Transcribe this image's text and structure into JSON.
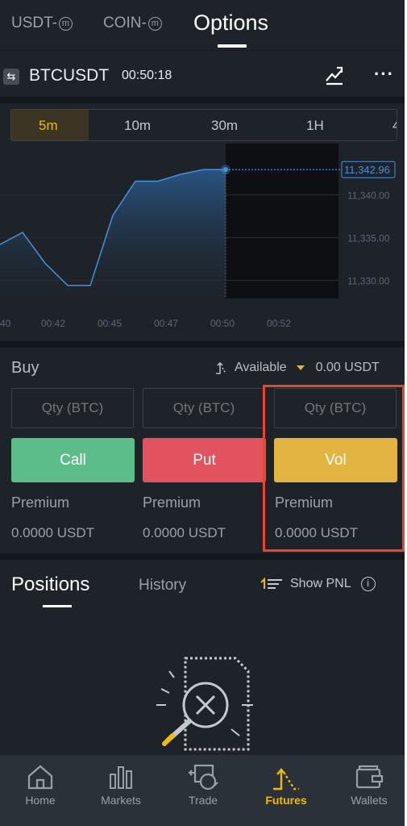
{
  "colors": {
    "background": "#1e2329",
    "accent": "#f0b90b",
    "call": "#5dbd8a",
    "put": "#e2525f",
    "vol": "#e3b442",
    "line": "#4a90d9",
    "highlight": "#e8462a"
  },
  "top_tabs": [
    {
      "label": "USDT-",
      "badge": "m"
    },
    {
      "label": "COIN-",
      "badge": "m"
    },
    {
      "label": "Options",
      "active": true
    }
  ],
  "symbol_bar": {
    "symbol": "BTCUSDT",
    "countdown": "00:50:18",
    "icons": [
      "swap-icon",
      "chart-type-icon",
      "more-icon"
    ]
  },
  "intervals": {
    "items": [
      "5m",
      "10m",
      "30m",
      "1H",
      "4"
    ],
    "selected": "5m"
  },
  "chart_data": {
    "type": "area",
    "x": [
      "00:40",
      "00:41",
      "00:42",
      "00:43",
      "00:44",
      "00:45",
      "00:46",
      "00:47",
      "00:48",
      "00:49",
      "00:50"
    ],
    "values": [
      11334.2,
      11335.6,
      11332.0,
      11329.4,
      11329.4,
      11337.6,
      11341.6,
      11341.6,
      11342.4,
      11342.96,
      11342.96
    ],
    "current_price_label": "11,342.96",
    "y_ticks": [
      "11,340.00",
      "11,335.00",
      "11,330.00"
    ],
    "x_ticks": [
      "40",
      "00:42",
      "00:45",
      "00:47",
      "00:50",
      "00:52"
    ],
    "ylim": [
      11327.6,
      11346.0
    ]
  },
  "buy": {
    "title": "Buy",
    "available_label": "Available",
    "available_value": "0.00 USDT",
    "options": [
      {
        "placeholder": "Qty (BTC)",
        "button": "Call",
        "premium_label": "Premium",
        "premium_value": "0.0000 USDT"
      },
      {
        "placeholder": "Qty (BTC)",
        "button": "Put",
        "premium_label": "Premium",
        "premium_value": "0.0000 USDT"
      },
      {
        "placeholder": "Qty (BTC)",
        "button": "Vol",
        "premium_label": "Premium",
        "premium_value": "0.0000 USDT"
      }
    ]
  },
  "positions": {
    "tab_positions": "Positions",
    "tab_history": "History",
    "show_pnl": "Show PNL"
  },
  "bottom_nav": [
    {
      "label": "Home",
      "icon": "home-icon"
    },
    {
      "label": "Markets",
      "icon": "markets-icon"
    },
    {
      "label": "Trade",
      "icon": "trade-icon"
    },
    {
      "label": "Futures",
      "icon": "futures-icon",
      "active": true
    },
    {
      "label": "Wallets",
      "icon": "wallets-icon"
    }
  ]
}
